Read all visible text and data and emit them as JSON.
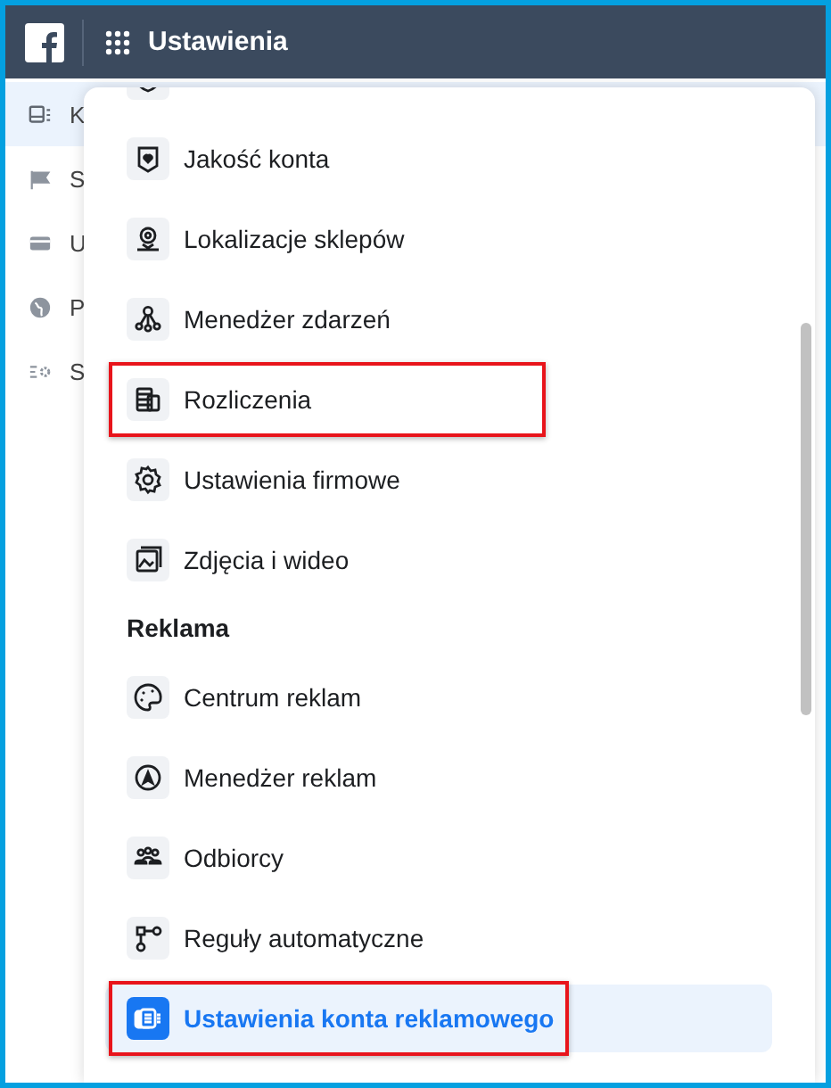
{
  "header": {
    "title": "Ustawienia"
  },
  "sidebar": {
    "items": [
      {
        "label": "K",
        "selected": true
      },
      {
        "label": "S",
        "selected": false
      },
      {
        "label": "U",
        "selected": false
      },
      {
        "label": "P",
        "selected": false
      },
      {
        "label": "S",
        "selected": false
      }
    ]
  },
  "menu": {
    "items": [
      {
        "kind": "partial"
      },
      {
        "kind": "item",
        "label": "Jakość konta",
        "selected": false,
        "highlighted": false
      },
      {
        "kind": "item",
        "label": "Lokalizacje sklepów",
        "selected": false,
        "highlighted": false
      },
      {
        "kind": "item",
        "label": "Menedżer zdarzeń",
        "selected": false,
        "highlighted": false
      },
      {
        "kind": "item",
        "label": "Rozliczenia",
        "selected": false,
        "highlighted": true
      },
      {
        "kind": "item",
        "label": "Ustawienia firmowe",
        "selected": false,
        "highlighted": false
      },
      {
        "kind": "item",
        "label": "Zdjęcia i wideo",
        "selected": false,
        "highlighted": false
      },
      {
        "kind": "section",
        "label": "Reklama"
      },
      {
        "kind": "item",
        "label": "Centrum reklam",
        "selected": false,
        "highlighted": false
      },
      {
        "kind": "item",
        "label": "Menedżer reklam",
        "selected": false,
        "highlighted": false
      },
      {
        "kind": "item",
        "label": "Odbiorcy",
        "selected": false,
        "highlighted": false
      },
      {
        "kind": "item",
        "label": "Reguły automatyczne",
        "selected": false,
        "highlighted": false
      },
      {
        "kind": "item",
        "label": "Ustawienia konta reklamowego",
        "selected": true,
        "highlighted": true
      }
    ]
  }
}
